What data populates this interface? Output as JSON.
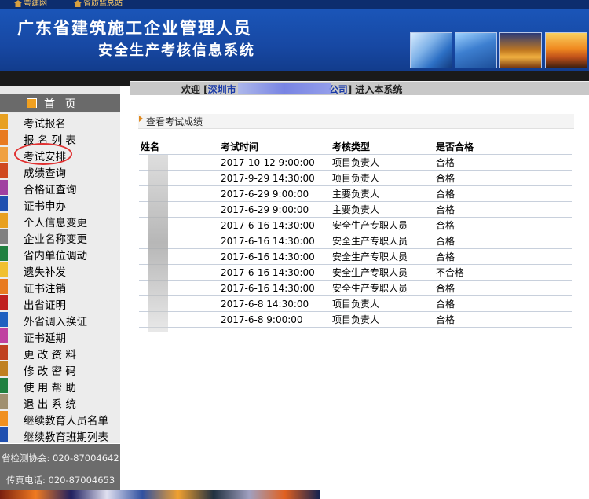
{
  "top_links": [
    {
      "label": "粤建网",
      "icon": "house-icon"
    },
    {
      "label": "省质监总站",
      "icon": "house-icon"
    }
  ],
  "banner": {
    "title_line1": "广东省建筑施工企业管理人员",
    "title_line2": "安全生产考核信息系统"
  },
  "welcome": {
    "prefix": "欢迎 [",
    "company_start": "深圳市",
    "company_end": "公司",
    "suffix": "] 进入本系统"
  },
  "sidebar": {
    "home_label": "首 页",
    "items": [
      {
        "label": "考试报名",
        "color": "#e8a020"
      },
      {
        "label": "报 名 列 表",
        "color": "#e87a20"
      },
      {
        "label": "考试安排",
        "color": "#f0a040"
      },
      {
        "label": "成绩查询",
        "color": "#d04a20"
      },
      {
        "label": "合格证查询",
        "color": "#a040a0"
      },
      {
        "label": "证书申办",
        "color": "#2050b0"
      },
      {
        "label": "个人信息变更",
        "color": "#e8a020"
      },
      {
        "label": "企业名称变更",
        "color": "#808080"
      },
      {
        "label": "省内单位调动",
        "color": "#208040"
      },
      {
        "label": "遗失补发",
        "color": "#f0c030"
      },
      {
        "label": "证书注销",
        "color": "#e87a20"
      },
      {
        "label": "出省证明",
        "color": "#c02020"
      },
      {
        "label": "外省调入换证",
        "color": "#2060c0"
      },
      {
        "label": "证书延期",
        "color": "#c040a0"
      },
      {
        "label": "更 改 资 料",
        "color": "#c04020"
      },
      {
        "label": "修 改 密 码",
        "color": "#c08020"
      },
      {
        "label": "使 用 帮 助",
        "color": "#208040"
      },
      {
        "label": "退 出 系 统",
        "color": "#a09070"
      },
      {
        "label": "继续教育人员名单",
        "color": "#f09020"
      },
      {
        "label": "继续教育班期列表",
        "color": "#2050b0"
      }
    ],
    "contact_association": "省检测协会: 020-87004642",
    "contact_fax": "传真电话: 020-87004653"
  },
  "content": {
    "section_title": "查看考试成绩",
    "table": {
      "headers": [
        "姓名",
        "考试时间",
        "考核类型",
        "是否合格"
      ],
      "rows": [
        [
          "",
          "2017-10-12 9:00:00",
          "项目负责人",
          "合格"
        ],
        [
          "",
          "2017-9-29 14:30:00",
          "项目负责人",
          "合格"
        ],
        [
          "",
          "2017-6-29 9:00:00",
          "主要负责人",
          "合格"
        ],
        [
          "",
          "2017-6-29 9:00:00",
          "主要负责人",
          "合格"
        ],
        [
          "",
          "2017-6-16 14:30:00",
          "安全生产专职人员",
          "合格"
        ],
        [
          "",
          "2017-6-16 14:30:00",
          "安全生产专职人员",
          "合格"
        ],
        [
          "",
          "2017-6-16 14:30:00",
          "安全生产专职人员",
          "合格"
        ],
        [
          "",
          "2017-6-16 14:30:00",
          "安全生产专职人员",
          "不合格"
        ],
        [
          "",
          "2017-6-16 14:30:00",
          "安全生产专职人员",
          "合格"
        ],
        [
          "",
          "2017-6-8 14:30:00",
          "项目负责人",
          "合格"
        ],
        [
          "",
          "2017-6-8 9:00:00",
          "项目负责人",
          "合格"
        ]
      ]
    }
  }
}
